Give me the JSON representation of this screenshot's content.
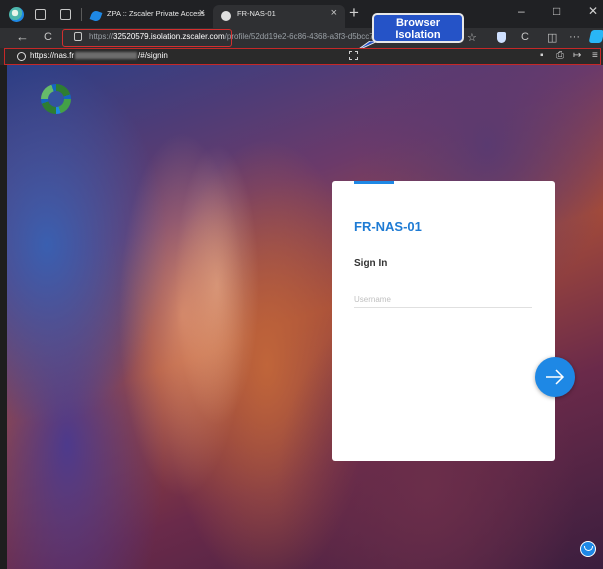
{
  "tabs": [
    {
      "title": "ZPA :: Zscaler Private Access",
      "close": "×"
    },
    {
      "title": "FR-NAS-01",
      "close": "×"
    }
  ],
  "new_tab": "+",
  "window_controls": {
    "minimize": "–",
    "maximize": "□",
    "close": "✕"
  },
  "nav": {
    "back": "←",
    "reload": "C"
  },
  "address": {
    "proto": "https://",
    "host": "32520579.isolation.zscaler.com",
    "path": "/profile/52dd19e2-6c86-4368-a3f3-d5bcc70"
  },
  "toolbar_icons": {
    "star": "☆",
    "refresh": "C",
    "split": "◫",
    "more": "···"
  },
  "callout": {
    "line1": "Browser",
    "line2": "Isolation"
  },
  "isolation_bar": {
    "url_prefix": "https://nas.fr",
    "url_suffix": "/#/signin",
    "icons": {
      "doc": "▪",
      "print": "⎙",
      "share": "↦",
      "menu": "≡"
    }
  },
  "login": {
    "title": "FR-NAS-01",
    "subtitle": "Sign In",
    "username_placeholder": "Username"
  },
  "colors": {
    "accent": "#1e88e5",
    "callout": "#2553c7",
    "highlight": "#d32f2f"
  }
}
